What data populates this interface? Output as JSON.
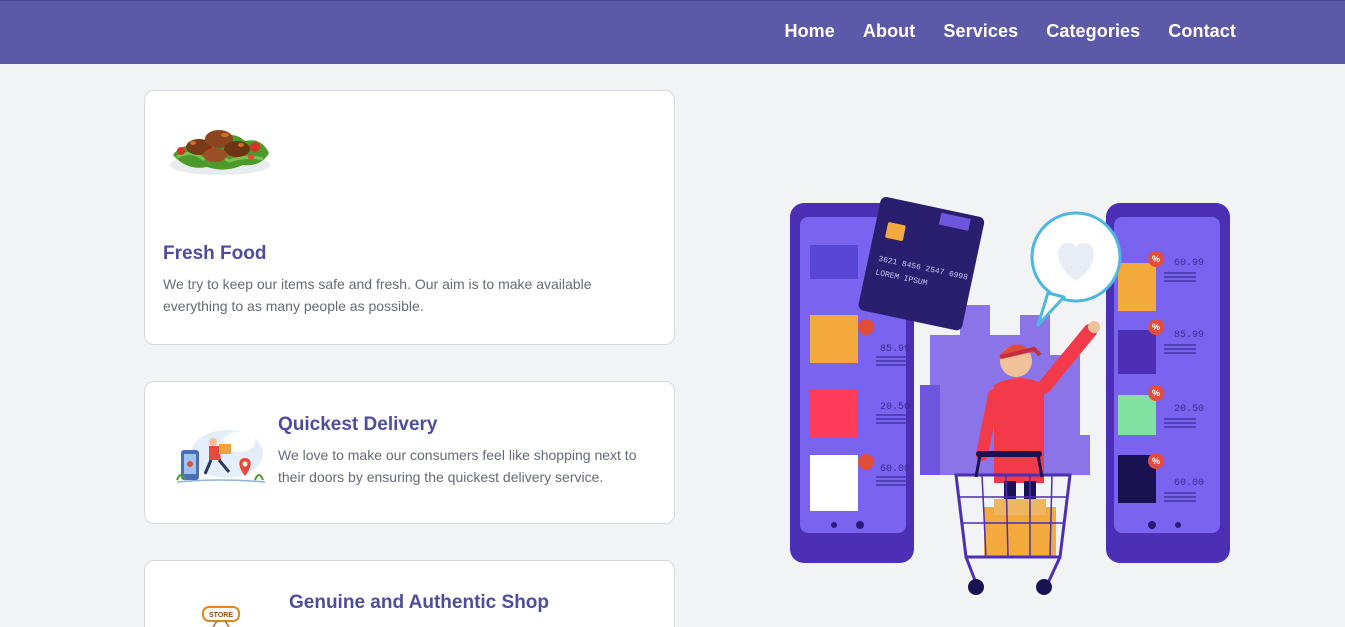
{
  "nav": {
    "items": [
      {
        "label": "Home"
      },
      {
        "label": "About"
      },
      {
        "label": "Services"
      },
      {
        "label": "Categories"
      },
      {
        "label": "Contact"
      }
    ]
  },
  "features": [
    {
      "title": "Fresh Food",
      "text": "We try to keep our items safe and fresh. Our aim is to make available everything to as many people as possible.",
      "image": "fresh-food-image"
    },
    {
      "title": "Quickest Delivery",
      "text": "We love to make our consumers feel like shopping next to their doors by ensuring the quickest delivery service.",
      "image": "delivery-image"
    },
    {
      "title": "Genuine and Authentic Shop",
      "image": "store-image",
      "image_label": "STORE"
    }
  ],
  "hero": {
    "image": "online-shopping-illustration",
    "card_number": "3621 8456 2547 6998",
    "card_name": "LOREM IPSUM",
    "left_prices": [
      "85.99",
      "20.50",
      "60.00"
    ],
    "right_prices": [
      "60.99",
      "85.99",
      "20.50",
      "60.00"
    ],
    "discount_symbol": "%"
  },
  "colors": {
    "navbar": "#5c5aa8",
    "accent": "#4f4c9c",
    "background": "#f2f3f5"
  }
}
